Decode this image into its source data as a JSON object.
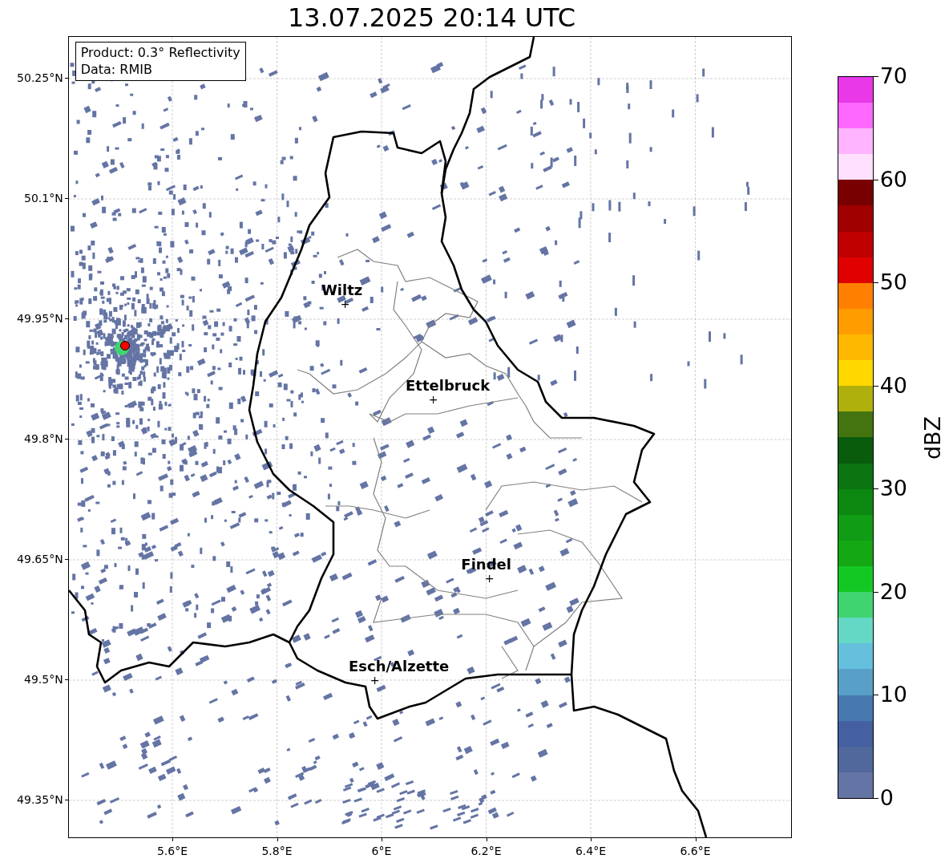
{
  "title": "13.07.2025 20:14 UTC",
  "info_box": {
    "lines": [
      "Product: 0.3° Reflectivity",
      "Data: RMIB"
    ]
  },
  "y_ticks": [
    "50.25°N",
    "50.1°N",
    "49.95°N",
    "49.8°N",
    "49.65°N",
    "49.5°N",
    "49.35°N"
  ],
  "x_ticks": [
    "5.6°E",
    "5.8°E",
    "6°E",
    "6.2°E",
    "6.4°E",
    "6.6°E"
  ],
  "cities": [
    {
      "name": "Wiltz",
      "marker": "+"
    },
    {
      "name": "Ettelbruck",
      "marker": "+"
    },
    {
      "name": "Findel",
      "marker": "+"
    },
    {
      "name": "Esch/Alzette",
      "marker": "+"
    }
  ],
  "colorbar": {
    "label": "dBZ",
    "ticks": [
      "70",
      "60",
      "50",
      "40",
      "30",
      "20",
      "10",
      "0"
    ],
    "segments": [
      {
        "color": "#6474a4"
      },
      {
        "color": "#50689c"
      },
      {
        "color": "#4460a0"
      },
      {
        "color": "#4878b0"
      },
      {
        "color": "#58a0c8"
      },
      {
        "color": "#64c0dc"
      },
      {
        "color": "#64d8c4"
      },
      {
        "color": "#40d470"
      },
      {
        "color": "#14c824"
      },
      {
        "color": "#14a814"
      },
      {
        "color": "#109c14"
      },
      {
        "color": "#0c8810"
      },
      {
        "color": "#0c7410"
      },
      {
        "color": "#085c0c"
      },
      {
        "color": "#447410"
      },
      {
        "color": "#b0b00c"
      },
      {
        "color": "#ffd800"
      },
      {
        "color": "#ffb800"
      },
      {
        "color": "#ff9c00"
      },
      {
        "color": "#ff8000"
      },
      {
        "color": "#e00000"
      },
      {
        "color": "#c00000"
      },
      {
        "color": "#a00000"
      },
      {
        "color": "#780000"
      },
      {
        "color": "#ffe0ff"
      },
      {
        "color": "#ffb4ff"
      },
      {
        "color": "#ff68ff"
      },
      {
        "color": "#e838e8"
      }
    ]
  }
}
